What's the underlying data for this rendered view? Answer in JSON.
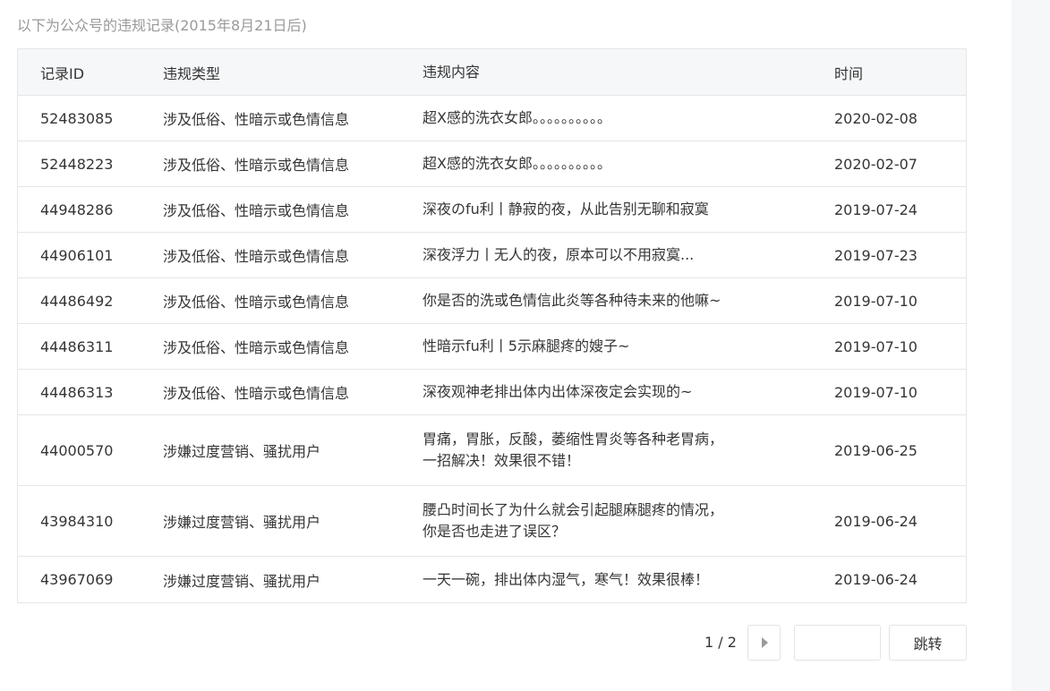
{
  "intro_text": "以下为公众号的违规记录(2015年8月21日后)",
  "table": {
    "headers": {
      "id": "记录ID",
      "type": "违规类型",
      "content": "违规内容",
      "time": "时间"
    },
    "rows": [
      {
        "id": "52483085",
        "type": "涉及低俗、性暗示或色情信息",
        "content": [
          "超X感的洗衣女郎。。。。。。。。。。"
        ],
        "time": "2020-02-08"
      },
      {
        "id": "52448223",
        "type": "涉及低俗、性暗示或色情信息",
        "content": [
          "超X感的洗衣女郎。。。。。。。。。。"
        ],
        "time": "2020-02-07"
      },
      {
        "id": "44948286",
        "type": "涉及低俗、性暗示或色情信息",
        "content": [
          "深夜のfu利丨静寂的夜，从此告别无聊和寂寞"
        ],
        "time": "2019-07-24"
      },
      {
        "id": "44906101",
        "type": "涉及低俗、性暗示或色情信息",
        "content": [
          "深夜浮力丨无人的夜，原本可以不用寂寞..."
        ],
        "time": "2019-07-23"
      },
      {
        "id": "44486492",
        "type": "涉及低俗、性暗示或色情信息",
        "content": [
          "你是否的洗或色情信此炎等各种待未来的他嘛~"
        ],
        "time": "2019-07-10"
      },
      {
        "id": "44486311",
        "type": "涉及低俗、性暗示或色情信息",
        "content": [
          "性暗示fu利丨5示麻腿疼的嫂子~"
        ],
        "time": "2019-07-10"
      },
      {
        "id": "44486313",
        "type": "涉及低俗、性暗示或色情信息",
        "content": [
          "深夜观神老排出体内出体深夜定会实现的~"
        ],
        "time": "2019-07-10"
      },
      {
        "id": "44000570",
        "type": "涉嫌过度营销、骚扰用户",
        "content": [
          "胃痛，胃胀，反酸，萎缩性胃炎等各种老胃病，",
          "一招解决！效果很不错！"
        ],
        "time": "2019-06-25"
      },
      {
        "id": "43984310",
        "type": "涉嫌过度营销、骚扰用户",
        "content": [
          "腰凸时间长了为什么就会引起腿麻腿疼的情况，",
          "你是否也走进了误区？"
        ],
        "time": "2019-06-24"
      },
      {
        "id": "43967069",
        "type": "涉嫌过度营销、骚扰用户",
        "content": [
          "一天一碗，排出体内湿气，寒气！效果很棒！"
        ],
        "time": "2019-06-24"
      }
    ]
  },
  "pagination": {
    "indicator": "1 / 2",
    "next_icon": "triangle-right-icon",
    "jump_input_value": "",
    "jump_input_placeholder": "",
    "jump_button_label": "跳转"
  },
  "colors": {
    "header_bg": "#f6f7f9",
    "border": "#e6e6e6",
    "muted_text": "#9a9a9a",
    "body_text": "#353535",
    "right_panel_bg": "#f6f7f9"
  }
}
